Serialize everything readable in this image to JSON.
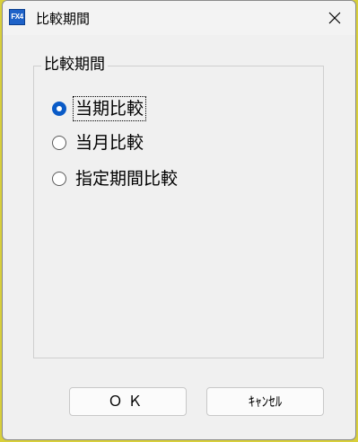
{
  "window": {
    "title": "比較期間",
    "app_icon_text": "FX4",
    "close_icon": "close-icon"
  },
  "group": {
    "legend": "比較期間",
    "options": [
      {
        "label": "当期比較",
        "checked": true
      },
      {
        "label": "当月比較",
        "checked": false
      },
      {
        "label": "指定期間比較",
        "checked": false
      }
    ]
  },
  "buttons": {
    "ok_label": "ＯＫ",
    "cancel_label": "ｷｬﾝｾﾙ"
  },
  "colors": {
    "accent": "#0a5bc7",
    "window_bg": "#f0f0f0",
    "desktop_bg": "#d8cf3a"
  }
}
